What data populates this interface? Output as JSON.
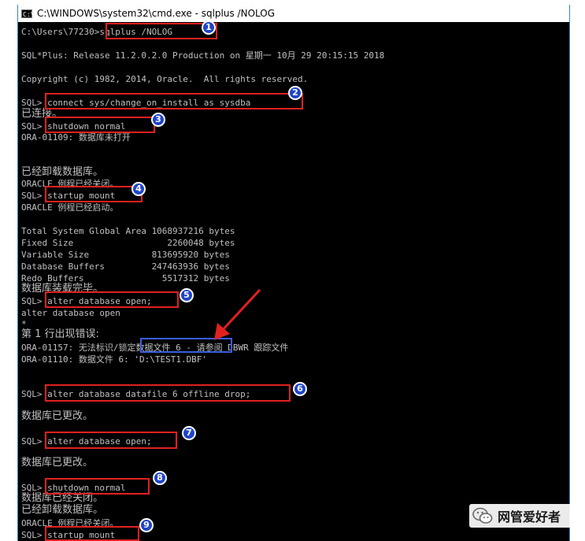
{
  "window": {
    "title": "C:\\WINDOWS\\system32\\cmd.exe - sqlplus  /NOLOG",
    "icon": "cmd-icon",
    "icon_glyph": "C:\\"
  },
  "console": {
    "lines": [
      "C:\\Users\\77230>sqlplus /NOLOG",
      "SQL*Plus: Release 11.2.0.2.0 Production on 星期一 10月 29 20:15:15 2018",
      "Copyright (c) 1982, 2014, Oracle.  All rights reserved.",
      "SQL> connect sys/change_on_install as sysdba",
      "已连接。",
      "SQL> shutdown normal",
      "ORA-01109: 数据库未打开",
      "已经卸载数据库。",
      "ORACLE 例程已经关闭。",
      "SQL> startup mount",
      "ORACLE 例程已经启动。",
      "Total System Global Area 1068937216 bytes",
      "Fixed Size                  2260048 bytes",
      "Variable Size            813695920 bytes",
      "Database Buffers         247463936 bytes",
      "Redo Buffers               5517312 bytes",
      "数据库装载完毕。",
      "SQL> alter database open;",
      "alter database open",
      "*",
      "第 1 行出现错误:",
      "ORA-01157: 无法标识/锁定数据文件 6 - 请参阅 DBWR 跟踪文件",
      "ORA-01110: 数据文件 6: 'D:\\TEST1.DBF'",
      "SQL> alter database datafile 6 offline drop;",
      "数据库已更改。",
      "SQL> alter database open;",
      "数据库已更改。",
      "SQL> shutdown normal",
      "数据库已经关闭。",
      "已经卸载数据库。",
      "ORACLE 例程已经关闭。",
      "SQL> startup mount"
    ]
  },
  "annotations": {
    "badges": [
      "1",
      "2",
      "3",
      "4",
      "5",
      "6",
      "7",
      "8",
      "9"
    ],
    "highlight_color": "#e0211f",
    "badge_color": "#1f45c9",
    "blue_box_color": "#3b5de0"
  },
  "watermark": {
    "text": "网管爱好者",
    "icon": "wechat-icon"
  }
}
